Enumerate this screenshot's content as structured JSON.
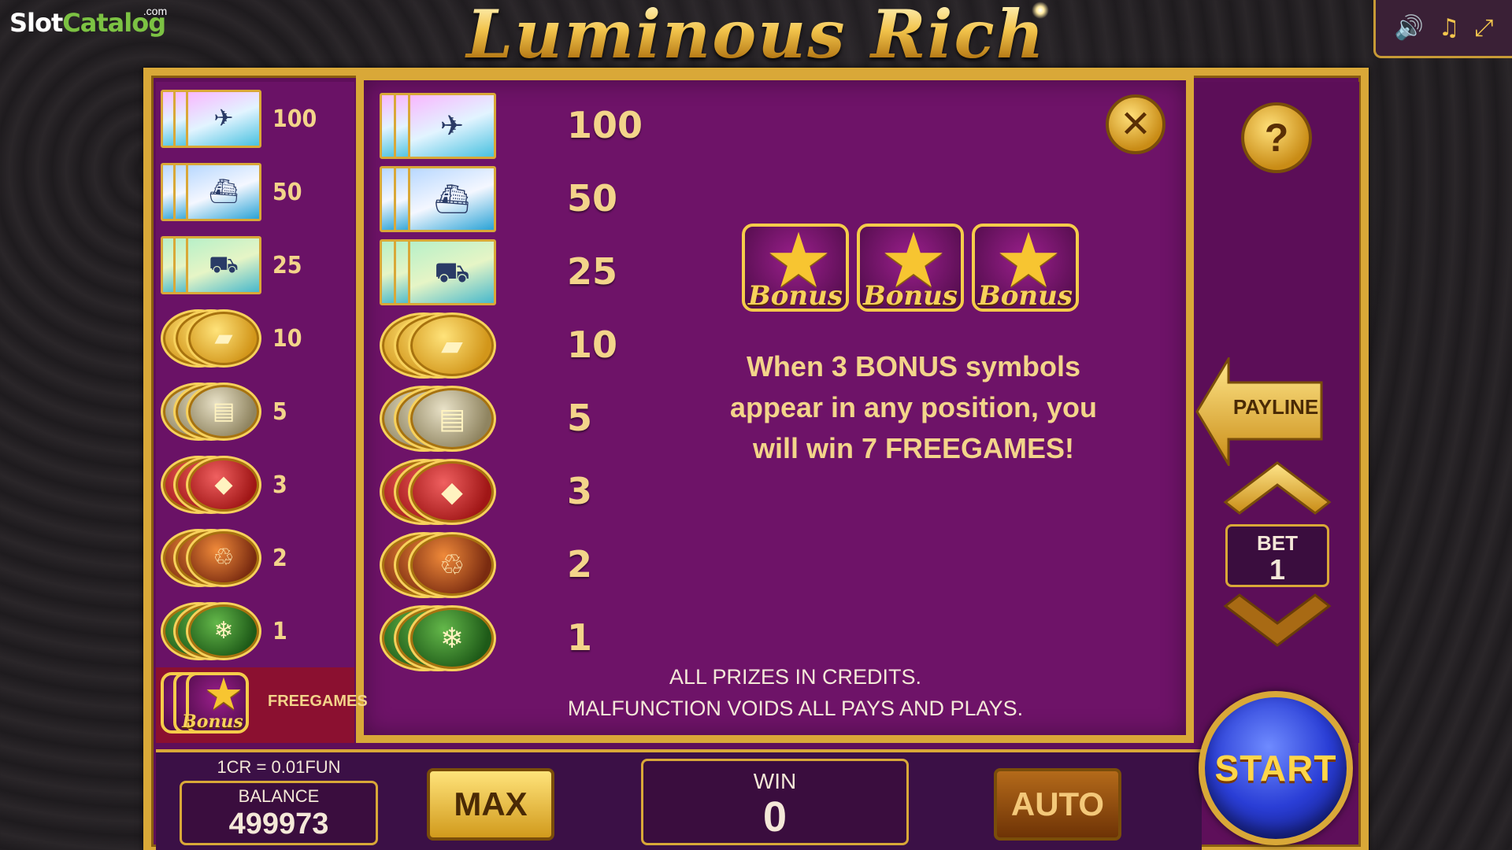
{
  "brand": {
    "name_a": "Slot",
    "name_b": "Catalog",
    "suffix": ".com"
  },
  "game": {
    "title": "Luminous Rich"
  },
  "controls": {
    "sound_icon": "speaker-icon",
    "music_icon": "music-note-icon",
    "exit_icon": "collapse-icon"
  },
  "paytable": [
    {
      "symbol": "plane",
      "icon": "airplane-icon",
      "pay": "100"
    },
    {
      "symbol": "yacht",
      "icon": "yacht-icon",
      "pay": "50"
    },
    {
      "symbol": "car",
      "icon": "sports-car-icon",
      "pay": "25"
    },
    {
      "symbol": "gold",
      "icon": "gold-bars-icon",
      "pay": "10"
    },
    {
      "symbol": "cash",
      "icon": "cash-stack-icon",
      "pay": "5"
    },
    {
      "symbol": "ring",
      "icon": "ring-box-icon",
      "pay": "3"
    },
    {
      "symbol": "cognac",
      "icon": "cognac-bottle-icon",
      "pay": "2"
    },
    {
      "symbol": "champagne",
      "icon": "champagne-icon",
      "pay": "1"
    }
  ],
  "freegames_row": {
    "label": "FREEGAMES",
    "symbol_text": "Bonus"
  },
  "bonus": {
    "symbol_text": "Bonus",
    "description": "When 3 BONUS symbols appear in any position, you will win 7 FREEGAMES!"
  },
  "footnote": {
    "line1": "ALL PRIZES IN CREDITS.",
    "line2": "MALFUNCTION VOIDS ALL PAYS AND PLAYS."
  },
  "right_controls": {
    "help": "?",
    "payline": "PAYLINE",
    "bet_label": "BET",
    "bet_value": "1"
  },
  "bottom": {
    "credit_rate": "1CR = 0.01FUN",
    "balance_label": "BALANCE",
    "balance_value": "499973",
    "max_label": "MAX",
    "win_label": "WIN",
    "win_value": "0",
    "auto_label": "AUTO",
    "start_label": "START"
  },
  "colors": {
    "gold": "#d9a838",
    "purple": "#6e1368",
    "start_blue": "#2a3ed6"
  }
}
